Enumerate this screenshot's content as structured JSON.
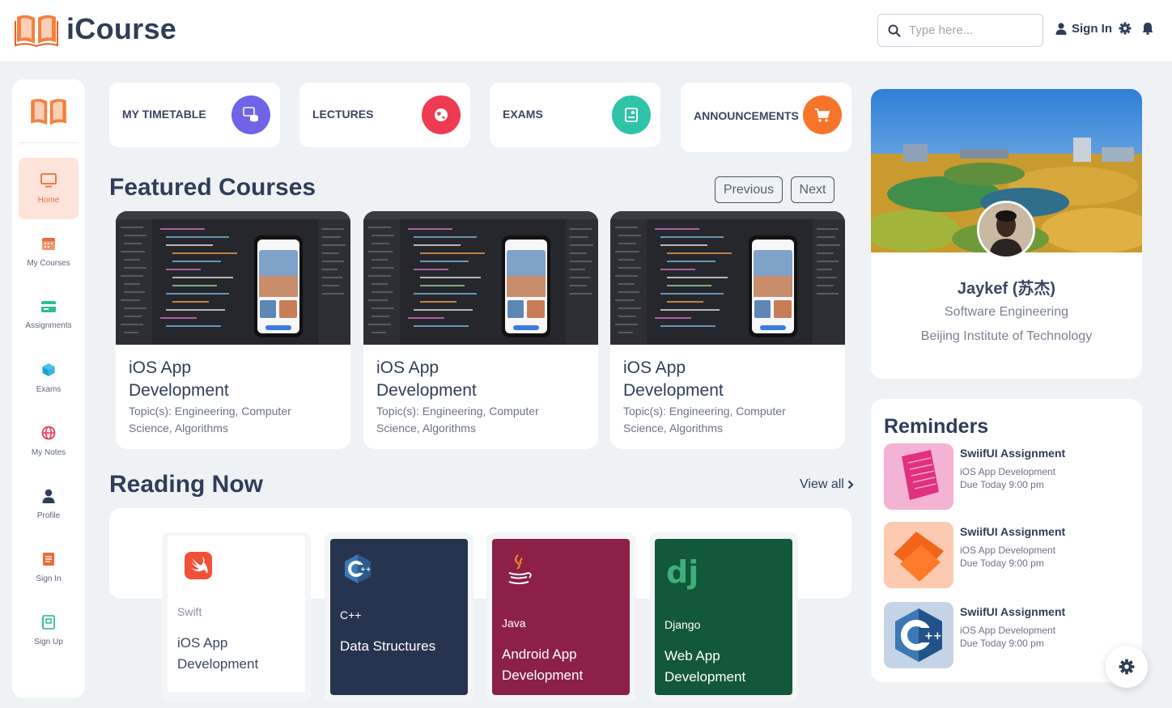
{
  "header": {
    "brand": "iCourse",
    "search_placeholder": "Type here...",
    "signin_label": "Sign In",
    "icons": [
      "search-icon",
      "user-icon",
      "gear-icon",
      "bell-icon"
    ]
  },
  "sidebar": {
    "items": [
      {
        "label": "Home",
        "icon": "monitor-icon",
        "active": true
      },
      {
        "label": "My Courses",
        "icon": "calendar-icon"
      },
      {
        "label": "Assignments",
        "icon": "card-icon"
      },
      {
        "label": "Exams",
        "icon": "cube-icon"
      },
      {
        "label": "My Notes",
        "icon": "globe-icon"
      },
      {
        "label": "Profile",
        "icon": "user-icon"
      },
      {
        "label": "Sign In",
        "icon": "document-icon"
      },
      {
        "label": "Sign Up",
        "icon": "notebook-icon"
      }
    ]
  },
  "quick_cards": [
    {
      "label": "MY TIMETABLE",
      "color": "#6f64e8",
      "icon": "database-icon"
    },
    {
      "label": "LECTURES",
      "color": "#ee3b52",
      "icon": "globe-icon"
    },
    {
      "label": "EXAMS",
      "color": "#2fc3a8",
      "icon": "document-icon"
    },
    {
      "label": "ANNOUNCEMENTS",
      "color": "#f7742b",
      "icon": "cart-icon"
    }
  ],
  "featured": {
    "title": "Featured Courses",
    "prev_label": "Previous",
    "next_label": "Next",
    "courses": [
      {
        "title": "iOS App Development",
        "topics": "Topic(s): Engineering, Computer Science, Algorithms"
      },
      {
        "title": "iOS App Development",
        "topics": "Topic(s): Engineering, Computer Science, Algorithms"
      },
      {
        "title": "iOS App Development",
        "topics": "Topic(s): Engineering, Computer Science, Algorithms"
      }
    ]
  },
  "reading": {
    "title": "Reading Now",
    "view_all": "View all",
    "books": [
      {
        "lang": "Swift",
        "title": "iOS App Development",
        "bg": "#ffffff",
        "icon": "swift-icon"
      },
      {
        "lang": "C++",
        "title": "Data Structures",
        "bg": "#27344f",
        "icon": "cpp-icon"
      },
      {
        "lang": "Java",
        "title": "Android App Development",
        "bg": "#8c2047",
        "icon": "java-icon"
      },
      {
        "lang": "Django",
        "title": "Web App Development",
        "bg": "#12583a",
        "icon": "django-icon"
      }
    ]
  },
  "profile": {
    "name": "Jaykef (苏杰)",
    "major": "Software Engineering",
    "school": "Beijing Institute of Technology"
  },
  "reminders": {
    "title": "Reminders",
    "items": [
      {
        "title": "SwiifUI Assignment",
        "course": "iOS App Development",
        "due": "Due Today 9:00 pm",
        "bg": "#f4b3d4"
      },
      {
        "title": "SwiifUI Assignment",
        "course": "iOS App Development",
        "due": "Due Today 9:00 pm",
        "bg": "#fccab0"
      },
      {
        "title": "SwiifUI Assignment",
        "course": "iOS App Development",
        "due": "Due Today 9:00 pm",
        "bg": "#c4d4e6"
      }
    ]
  },
  "accent": "#f06a3a"
}
